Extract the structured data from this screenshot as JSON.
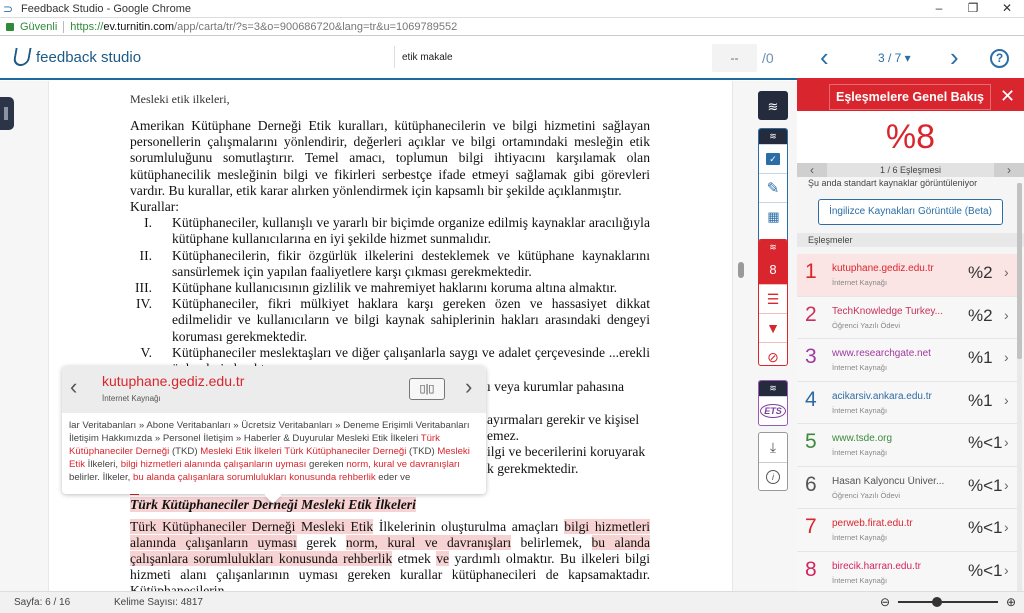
{
  "window": {
    "title": "Feedback Studio - Google Chrome",
    "controls": {
      "minimize": "–",
      "restore": "❐",
      "close": "✕"
    }
  },
  "address": {
    "secure_label": "Güvenli",
    "scheme": "https://",
    "host": "ev.turnitin.com",
    "path": "/app/carta/tr/?s=3&o=900686720&lang=tr&u=1069789552"
  },
  "header": {
    "brand": "feedback studio",
    "doc_title": "etik makale",
    "page_input": "--",
    "page_total": "/0",
    "prev_icon": "‹",
    "next_icon": "›",
    "pager": "3 / 7 ▾",
    "help": "?"
  },
  "document": {
    "cut_line": "Mesleki etik ilkeleri,",
    "para1": "Amerikan Kütüphane Derneği Etik kuralları, kütüphanecilerin ve bilgi hizmetini sağlayan personellerin çalışmalarını yönlendirir, değerleri açıklar ve bilgi ortamındaki mesleğin etik sorumluluğunu somutlaştırır. Temel amacı, toplumun bilgi ihtiyacını karşılamak olan kütüphanecilik mesleğinin bilgi ve fikirleri serbestçe ifade etmeyi sağlamak gibi görevleri vardır. Bu kurallar, etik karar alırken yönlendirmek için kapsamlı bir şekilde açıklanmıştır.",
    "rules_label": "Kurallar:",
    "rules": [
      {
        "num": "I.",
        "text": "Kütüphaneciler, kullanışlı ve yararlı bir biçimde organize edilmiş kaynaklar aracılığıyla kütüphane kullanıcılarına en iyi şekilde hizmet sunmalıdır."
      },
      {
        "num": "II.",
        "text": "Kütüphanecilerin, fikir özgürlük ilkelerini desteklemek ve kütüphane kaynaklarını sansürlemek için yapılan faaliyetlere karşı çıkması gerekmektedir."
      },
      {
        "num": "III.",
        "text": "Kütüphane kullanıcısının gizlilik ve mahremiyet haklarını koruma altına almaktır."
      },
      {
        "num": "IV.",
        "text": "Kütüphaneciler, fikri mülkiyet haklara karşı gereken özen ve hassasiyet dikkat edilmelidir ve kullanıcıların ve bilgi kaynak sahiplerinin hakları arasındaki dengeyi koruması gerekmektedir."
      },
      {
        "num": "V.",
        "text": "Kütüphaneciler meslektaşları ve diğer çalışanlarla saygı ve adalet çerçevesinde ...erekli önlemleri almaktır."
      }
    ],
    "hidden_fragments": [
      "...ı veya kurumlar pahasına",
      "...ayırmaları gerekir ve kişisel",
      "...emez.",
      "...ilgi ve becerilerini koruyarak",
      "...k gerekmektedir."
    ],
    "match_marker": "1",
    "heading": "Türk Kütüphaneciler Derneği Mesleki Etik İlkeleri",
    "para2": [
      {
        "t": "Türk Kütüphaneciler Derneği Mesleki Etik",
        "h": true
      },
      {
        "t": " İlkelerinin oluşturulma amaçları ",
        "h": false
      },
      {
        "t": "bilgi hizmetleri alanında çalışanların uyması",
        "h": true
      },
      {
        "t": " gerek ",
        "h": false
      },
      {
        "t": "norm, kural ve davranışları",
        "h": true
      },
      {
        "t": " belirlemek, ",
        "h": false
      },
      {
        "t": "bu alanda çalışanlara sorumlulukları konusunda rehberlik",
        "h": true
      },
      {
        "t": " etmek ",
        "h": false
      },
      {
        "t": "ve",
        "h": true
      },
      {
        "t": " yardımlı olmaktır. Bu ilkeleri bilgi hizmeti alanı çalışanlarının uyması gereken kurallar kütüphanecileri de kapsamaktadır. Kütüphanecilerin",
        "h": false
      }
    ]
  },
  "popup": {
    "source": "kutuphane.gediz.edu.tr",
    "type": "İnternet Kaynağı",
    "compare_icon": "▯|▯",
    "prev": "‹",
    "next": "›",
    "snippet": [
      {
        "t": "lar Veritabanları » Abone Veritabanları » Ücretsiz Veritabanları » Deneme Erişimli Veritabanları İletişim Hakkımızda » Personel İletişim » Haberler & Duyurular Mesleki Etik İlkeleri ",
        "r": false
      },
      {
        "t": "Türk Kütüphaneciler Derneği",
        "r": true
      },
      {
        "t": " (TKD) ",
        "r": false
      },
      {
        "t": "Mesleki Etik İlkeleri Türk Kütüphaneciler Derneği",
        "r": true
      },
      {
        "t": " (TKD) ",
        "r": false
      },
      {
        "t": "Mesleki Etik",
        "r": true
      },
      {
        "t": " İlkeleri, ",
        "r": false
      },
      {
        "t": "bilgi hizmetleri alanında çalışanların uyması",
        "r": true
      },
      {
        "t": " gereken ",
        "r": false
      },
      {
        "t": "norm, kural ve davranışları",
        "r": true
      },
      {
        "t": " belirler. İlkeler, ",
        "r": false
      },
      {
        "t": "bu alanda çalışanlara sorumlulukları konusunda rehberlik",
        "r": true
      },
      {
        "t": " eder ve",
        "r": false
      }
    ]
  },
  "toolbar": {
    "similarity_count": "8",
    "ets_label": "ETS"
  },
  "panel": {
    "title": "Eşleşmelere Genel Bakış",
    "close": "✕",
    "score": "%8",
    "match_nav": "1 / 6 Eşleşmesi",
    "standard_sources": "Şu anda standart kaynaklar görüntüleniyor",
    "english_button": "İngilizce Kaynakları Görüntüle (Beta)",
    "matches_label": "Eşleşmeler",
    "matches": [
      {
        "n": "1",
        "source": "kutuphane.gediz.edu.tr",
        "type": "İnternet Kaynağı",
        "pct": "%2",
        "color": "#d9262e",
        "active": true
      },
      {
        "n": "2",
        "source": "TechKnowledge Turkey...",
        "type": "Öğrenci Yazılı Ödevi",
        "pct": "%2",
        "color": "#c8305a",
        "active": false
      },
      {
        "n": "3",
        "source": "www.researchgate.net",
        "type": "İnternet Kaynağı",
        "pct": "%1",
        "color": "#a0399f",
        "active": false
      },
      {
        "n": "4",
        "source": "acikarsiv.ankara.edu.tr",
        "type": "İnternet Kaynağı",
        "pct": "%1",
        "color": "#2f6aa5",
        "active": false
      },
      {
        "n": "5",
        "source": "www.tsde.org",
        "type": "İnternet Kaynağı",
        "pct": "%<1",
        "color": "#3d8a3d",
        "active": false
      },
      {
        "n": "6",
        "source": "Hasan Kalyoncu Üniver...",
        "type": "Öğrenci Yazılı Ödevi",
        "pct": "%<1",
        "color": "#555555",
        "active": false
      },
      {
        "n": "7",
        "source": "perweb.firat.edu.tr",
        "type": "İnternet Kaynağı",
        "pct": "%<1",
        "color": "#d9262e",
        "active": false
      },
      {
        "n": "8",
        "source": "birecik.harran.edu.tr",
        "type": "İnternet Kaynağı",
        "pct": "%<1",
        "color": "#d4245f",
        "active": false
      }
    ]
  },
  "status": {
    "page": "Sayfa: 6 / 16",
    "word_count": "Kelime Sayısı: 4817",
    "zoom_level": 0.38
  },
  "colors": {
    "accent_blue": "#2b6ea6",
    "brand_red": "#d9262e",
    "highlight": "#f7d2d3"
  }
}
